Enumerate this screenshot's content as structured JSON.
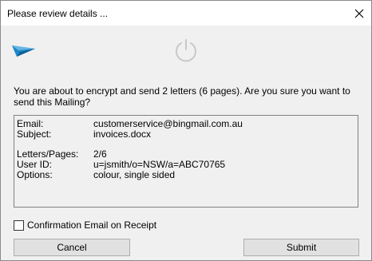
{
  "window": {
    "title": "Please review details ...",
    "close_icon": "close-icon"
  },
  "header": {
    "logo_icon": "paper-plane-icon",
    "status_icon": "power-icon"
  },
  "message": "You are about to encrypt and send 2 letters (6 pages). Are you sure you want to send this Mailing?",
  "details": {
    "email_label": "Email:",
    "email_value": "customerservice@bingmail.com.au",
    "subject_label": "Subject:",
    "subject_value": "invoices.docx",
    "letters_label": "Letters/Pages:",
    "letters_value": "2/6",
    "userid_label": "User ID:",
    "userid_value": "u=jsmith/o=NSW/a=ABC70765",
    "options_label": "Options:",
    "options_value": "colour, single sided"
  },
  "confirmation": {
    "label": "Confirmation Email on Receipt",
    "checked": false
  },
  "buttons": {
    "cancel": "Cancel",
    "submit": "Submit"
  },
  "colors": {
    "accent_blue": "#1e88c8",
    "power_icon": "#c8c8c8"
  }
}
